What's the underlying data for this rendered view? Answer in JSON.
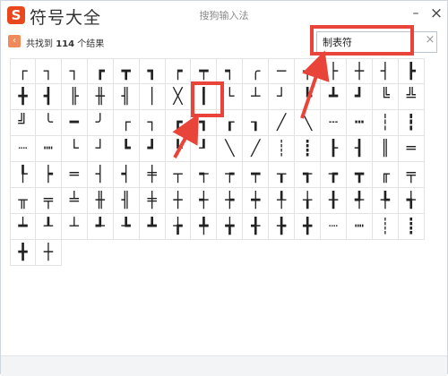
{
  "titlebar": {
    "logo_letter": "S",
    "app_title": "符号大全",
    "window_title": "搜狗输入法",
    "minimize_glyph": "–",
    "close_glyph": "×"
  },
  "toolbar": {
    "back_glyph": "‹",
    "result_prefix": "共找到",
    "result_count": "114",
    "result_suffix": "个结果"
  },
  "search": {
    "value": "制表符",
    "clear_glyph": "×"
  },
  "symbols": [
    [
      "┌",
      "┐",
      "┐",
      "┏",
      "┳",
      "┓",
      "┍",
      "┯",
      "┑",
      "╭",
      "─",
      "╮",
      "├",
      "┼",
      "┤",
      "┣"
    ],
    [
      "╋",
      "┫",
      "╟",
      "╫",
      "╢",
      "│",
      "╳",
      "┃",
      "└",
      "┴",
      "┘",
      "┗",
      "┻",
      "┛",
      "╚",
      "╩"
    ],
    [
      "╝",
      "╰",
      "━",
      "╯",
      "┌",
      "┐",
      "┏",
      "┓",
      "┎",
      "┒",
      "╱",
      "╲",
      "┄",
      "┅",
      "┆",
      "┇"
    ],
    [
      "┈",
      "┉",
      "└",
      "┘",
      "┗",
      "┛",
      "┖",
      "┚",
      "╲",
      "╱",
      "┊",
      "┋",
      "┠",
      "┨",
      "║",
      "═"
    ],
    [
      "┞",
      "┝",
      "═",
      "┤",
      "┥",
      "╪",
      "┬",
      "┭",
      "┮",
      "┯",
      "┰",
      "┱",
      "┲",
      "┳",
      "╓",
      "╤"
    ],
    [
      "╥",
      "╤",
      "╧",
      "╫",
      "╢",
      "╪",
      "┼",
      "┽",
      "┾",
      "┿",
      "╀",
      "╁",
      "╂",
      "╃",
      "╄",
      "╅"
    ],
    [
      "┷",
      "┸",
      "┴",
      "┹",
      "┺",
      "┻",
      "╆",
      "╇",
      "╈",
      "╉",
      "╊",
      "╋",
      "┈",
      "┉",
      "┊",
      "┋"
    ],
    [
      "╋",
      "┼"
    ]
  ]
}
